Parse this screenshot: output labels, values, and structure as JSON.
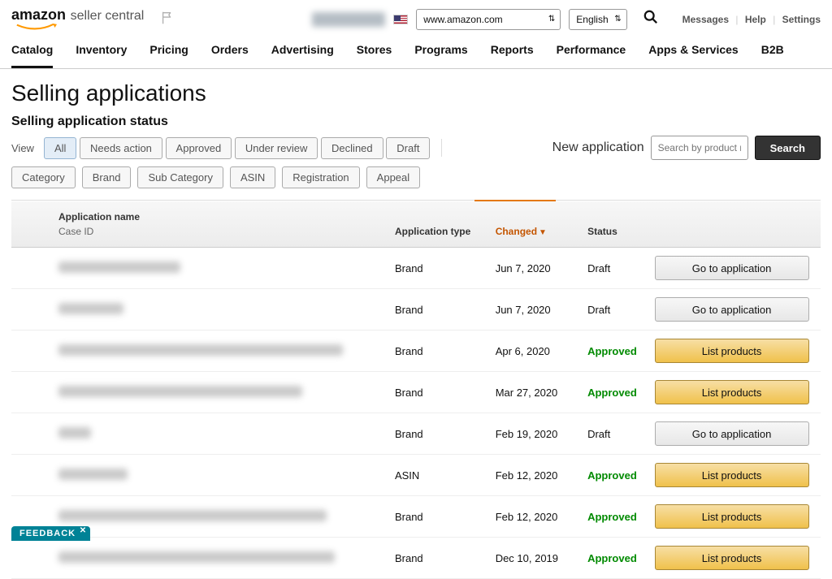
{
  "header": {
    "logo_main": "amazon",
    "logo_sub": "seller central",
    "domain_select": "www.amazon.com",
    "lang_select": "English",
    "links": {
      "messages": "Messages",
      "help": "Help",
      "settings": "Settings"
    }
  },
  "nav": {
    "tabs": [
      "Catalog",
      "Inventory",
      "Pricing",
      "Orders",
      "Advertising",
      "Stores",
      "Programs",
      "Reports",
      "Performance",
      "Apps & Services",
      "B2B"
    ],
    "active_index": 0
  },
  "page": {
    "title": "Selling applications",
    "section_title": "Selling application status"
  },
  "filters": {
    "view_label": "View",
    "row1": [
      "All",
      "Needs action",
      "Approved",
      "Under review",
      "Declined",
      "Draft"
    ],
    "row1_active_index": 0,
    "row2": [
      "Category",
      "Brand",
      "Sub Category",
      "ASIN",
      "Registration",
      "Appeal"
    ],
    "new_app_label": "New application",
    "new_app_placeholder": "Search by product n",
    "search_button": "Search"
  },
  "table": {
    "columns": {
      "name": "Application name",
      "name_sub": "Case ID",
      "type": "Application\ntype",
      "changed": "Changed",
      "status": "Status"
    },
    "buttons": {
      "go": "Go to application",
      "list": "List products"
    },
    "rows": [
      {
        "name_blur_w": 150,
        "type": "Brand",
        "changed": "Jun 7, 2020",
        "status": "Draft",
        "action": "go"
      },
      {
        "name_blur_w": 80,
        "type": "Brand",
        "changed": "Jun 7, 2020",
        "status": "Draft",
        "action": "go"
      },
      {
        "name_blur_w": 350,
        "type": "Brand",
        "changed": "Apr 6, 2020",
        "status": "Approved",
        "action": "list"
      },
      {
        "name_blur_w": 300,
        "type": "Brand",
        "changed": "Mar 27, 2020",
        "status": "Approved",
        "action": "list"
      },
      {
        "name_blur_w": 40,
        "type": "Brand",
        "changed": "Feb 19, 2020",
        "status": "Draft",
        "action": "go"
      },
      {
        "name_blur_w": 85,
        "type": "ASIN",
        "changed": "Feb 12, 2020",
        "status": "Approved",
        "action": "list"
      },
      {
        "name_blur_w": 330,
        "type": "Brand",
        "changed": "Feb 12, 2020",
        "status": "Approved",
        "action": "list"
      },
      {
        "name_blur_w": 340,
        "type": "Brand",
        "changed": "Dec 10, 2019",
        "status": "Approved",
        "action": "list"
      }
    ]
  },
  "feedback_label": "FEEDBACK"
}
